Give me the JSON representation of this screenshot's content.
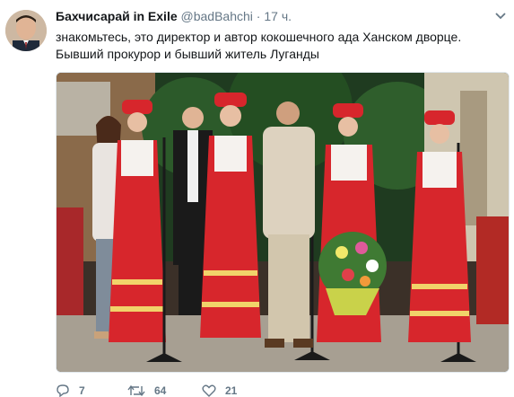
{
  "tweet": {
    "author_name": "Бахчисарай in Exile",
    "author_handle": "@badBahchi",
    "separator": "·",
    "timestamp": "17 ч.",
    "text_lines": [
      "знакомьтесь, это директор и автор кокошечного ада Ханском дворце.",
      "Бывший прокурор и бывший житель Луганды"
    ]
  },
  "actions": {
    "reply_count": "7",
    "retweet_count": "64",
    "like_count": "21"
  },
  "icons": {
    "avatar": "profile-photo",
    "caret": "chevron-down-icon",
    "reply": "reply-icon",
    "retweet": "retweet-icon",
    "like": "heart-icon"
  },
  "colors": {
    "text": "#14171a",
    "secondary": "#657786",
    "costume_red": "#d7262c",
    "costume_white": "#f5f2ee"
  }
}
